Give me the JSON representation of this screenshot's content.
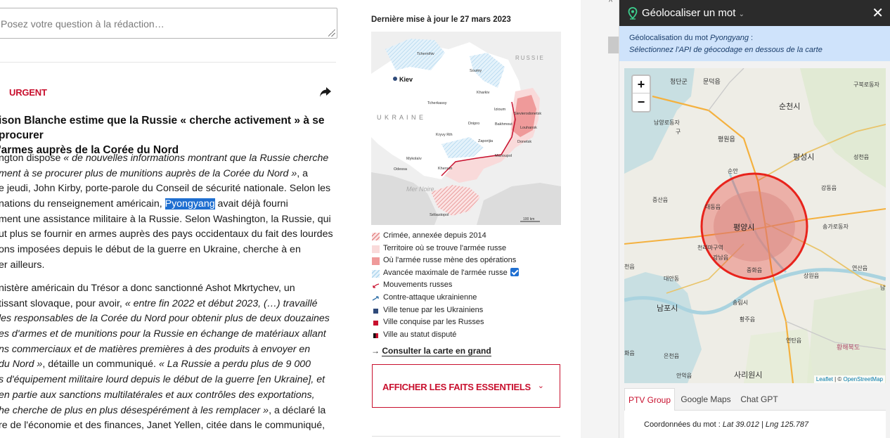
{
  "article": {
    "question_placeholder": "Posez votre question à la rédaction…",
    "urgent_label": "URGENT",
    "share_icon": "share-arrow-icon",
    "headline_l1": "ison Blanche estime que la Russie « cherche activement » à se procurer",
    "headline_l2": "'armes auprès de la Corée du Nord",
    "p1": {
      "l1_a": "ngton dispose ",
      "l1_b": "« de nouvelles informations montrant que la Russie cherche",
      "l2_a": "ment à se procurer plus de munitions auprès de la Corée du Nord »",
      "l2_b": ", a",
      "l3": "e jeudi, John Kirby, porte-parole du Conseil de sécurité nationale. Selon les",
      "l4_a": "nations du renseignement américain, ",
      "l4_hl": "Pyongyang",
      "l4_b": " avait déjà fourni",
      "l5": "ment une assistance militaire à la Russie. Selon Washington, la Russie, qui",
      "l6": "ut plus se fournir en armes auprès des pays occidentaux du fait des lourdes",
      "l7": "ons imposées depuis le début de la guerre en Ukraine, cherche à en",
      "l8": "er ailleurs."
    },
    "p2": {
      "l1": "nistère américain du Trésor a donc sanctionné Ashot Mkrtychev, un",
      "l2_a": "tissant slovaque, pour avoir, ",
      "l2_b": "« entre fin 2022 et début 2023, (…) travaillé",
      "l3": "les responsables de la Corée du Nord pour obtenir plus de deux douzaines",
      "l4": "es d'armes et de munitions pour la Russie en échange de matériaux allant",
      "l5": "ns commerciaux et de matières premières à des produits à envoyer en",
      "l6_a": "du Nord »",
      "l6_b": ", détaille un communiqué. ",
      "l6_c": "« La Russie a perdu plus de 9 000",
      "l7": "s d'équipement militaire lourd depuis le début de la guerre [en Ukraine], et",
      "l8": "en partie aux sanctions multilatérales et aux contrôles des exportations,",
      "l9_a": "he cherche de plus en plus désespérément à les remplacer »",
      "l9_b": ", a déclaré la",
      "l10": "re de l'économie et des finances, Janet Yellen, citée dans le communiqué,"
    }
  },
  "middle": {
    "updated": "Dernière mise à jour le 27 mars 2023",
    "map_labels": {
      "russie": "RUSSIE",
      "ukraine": "U K R A I N E",
      "kiev": "Kiev",
      "mer_noire": "Mer Noire",
      "tchernihiv": "Tchernihiv",
      "soumy": "Soumy",
      "kharkiv": "Kharkiv",
      "tcherkassy": "Tcherkassy",
      "izioum": "Izioum",
      "bakhmout": "Bakhmout",
      "sievierodonetsk": "Sievierodonetsk",
      "louhansk": "Louhansk",
      "dnipro": "Dnipro",
      "kryvy_rih": "Kryvy Rih",
      "zaporijia": "Zaporijia",
      "donetsk": "Donetsk",
      "marioupol": "Marioupol",
      "mykolaiv": "Mykolaïv",
      "kherson": "Kherson",
      "odessa": "Odessa",
      "sebastopol": "Sébastopol",
      "scale": "100 km"
    },
    "legend": [
      {
        "label": "Crimée, annexée depuis 2014",
        "swatch": "hatch-red"
      },
      {
        "label": "Territoire où se trouve l'armée russe",
        "swatch": "#f9dada"
      },
      {
        "label": "Où l'armée russe mène des opérations",
        "swatch": "#ef9a9a"
      },
      {
        "label": "Avancée maximale de l'armée russe",
        "swatch": "hatch-blue"
      },
      {
        "label": "Mouvements russes",
        "swatch": "arrow-red"
      },
      {
        "label": "Contre-attaque ukrainienne",
        "swatch": "arrow-blue"
      },
      {
        "label": "Ville tenue par les Ukrainiens",
        "swatch": "#2f4a7a"
      },
      {
        "label": "Ville conquise par les Russes",
        "swatch": "#c8102e"
      },
      {
        "label": "Ville au statut disputé",
        "swatch": "split"
      }
    ],
    "consult_arrow": "→",
    "consult_label": "Consulter la carte en grand",
    "facts_label": "AFFICHER LES FAITS ESSENTIELS",
    "facts_chevron": "⌄"
  },
  "panel": {
    "title": "Géolocaliser un mot",
    "title_chevron": "⌄",
    "close": "✕",
    "info_l1_a": "Géolocalisation du mot ",
    "info_l1_word": "Pyongyang",
    "info_l1_b": " :",
    "info_l2": "Sélectionnez l'API de géocodage en dessous de la carte",
    "zoom_in": "+",
    "zoom_out": "−",
    "map_labels": {
      "l_cheongdan": "청단군",
      "l_munkdok": "문덕읍",
      "l_suncheon": "순천시",
      "l_gubuk": "구북로동자",
      "l_namyang": "남양로동자",
      "l_gu": "구",
      "l_pyeongwon": "평원읍",
      "l_pyeongseong": "평성시",
      "l_seongcheon": "성천읍",
      "l_sunan": "순안",
      "l_jeungsan": "증산읍",
      "l_daedong": "대동읍",
      "l_gangdong": "강동읍",
      "l_pyongyang": "평양시",
      "l_songga": "송가로동자",
      "l_cheonri": "천리마구역",
      "l_nampo_small": "강남읍",
      "l_junghwa": "중화읍",
      "l_sangwon": "상원읍",
      "l_yeonsan": "연산읍",
      "l_daean": "대안동",
      "l_nampo": "남포시",
      "l_songrim": "송림시",
      "l_hwangju": "황주읍",
      "l_yeontan": "연탄읍",
      "l_hwanghaebuk": "황해북도",
      "l_eunchon": "은천읍",
      "l_anak": "안악읍",
      "l_sariwon": "사리원시",
      "l_cheon": "천읍",
      "l_nam": "남",
      "l_hwa": "화읍"
    },
    "attribution_leaflet": "Leaflet",
    "attribution_sep": " | © ",
    "attribution_osm": "OpenStreetMap",
    "tabs": [
      "PTV Group",
      "Google Maps",
      "Chat GPT"
    ],
    "active_tab": "PTV Group",
    "coords_prefix": "Coordonnées du mot : ",
    "coords_lat": "Lat 39.012",
    "coords_sep": " | ",
    "coords_lng": "Lng 125.787",
    "circle_color": "#e8231c",
    "highlight_color": "#1f6fd1"
  }
}
